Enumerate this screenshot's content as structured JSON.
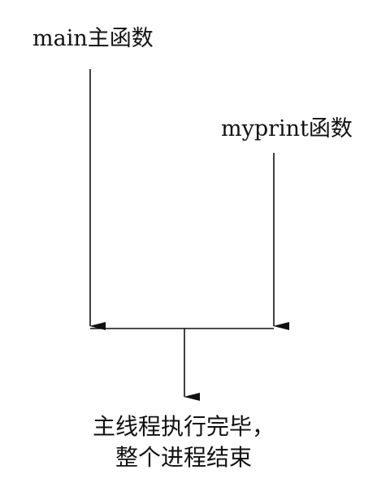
{
  "nodes": {
    "main": "main主函数",
    "myprint": "myprint函数",
    "end_line1": "主线程执行完毕，",
    "end_line2": "整个进程结束"
  },
  "colors": {
    "line": "#111111",
    "background": "#ffffff"
  }
}
